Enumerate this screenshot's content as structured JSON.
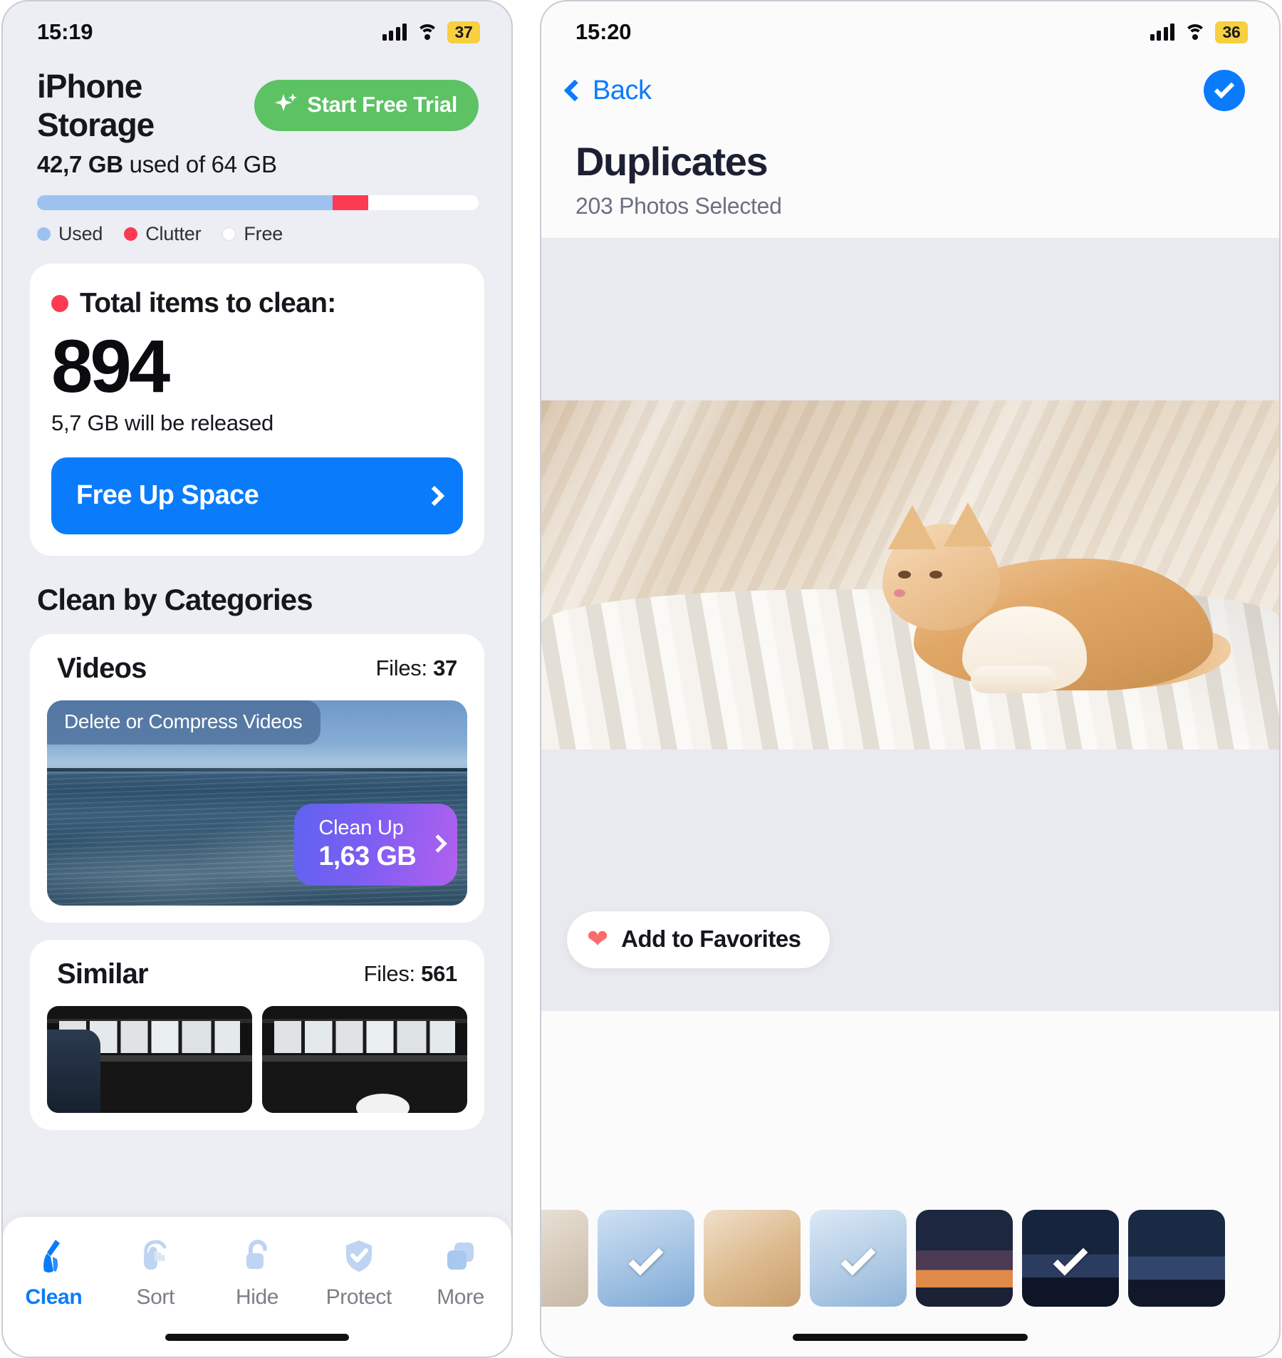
{
  "left": {
    "status": {
      "time": "15:19",
      "battery": "37",
      "signal_icon": "cellular-signal-icon",
      "wifi_icon": "wifi-icon"
    },
    "header": {
      "title": "iPhone Storage",
      "trial_button": "Start Free Trial",
      "trial_icon": "sparkle-icon",
      "usage_used": "42,7 GB",
      "usage_rest": " used of 64 GB"
    },
    "storage_bar": {
      "used_pct": 67,
      "clutter_pct": 8,
      "free_pct": 25,
      "used_color": "#9dc2ef",
      "clutter_color": "#fb3b53",
      "free_color": "#ffffff"
    },
    "legend": [
      {
        "label": "Used",
        "color": "#9dc2ef"
      },
      {
        "label": "Clutter",
        "color": "#fb3b53"
      },
      {
        "label": "Free",
        "color": "#ffffff"
      }
    ],
    "summary_card": {
      "dot_color": "#fb3b53",
      "heading": "Total items to clean:",
      "count": "894",
      "released": "5,7 GB will be released",
      "cta_label": "Free Up Space",
      "cta_color": "#0a7cfb",
      "cta_chevron": "chevron-right-icon"
    },
    "categories_heading": "Clean by Categories",
    "categories": [
      {
        "name": "Videos",
        "files_label": "Files: ",
        "files_count": "37",
        "media_chip": "Delete or Compress Videos",
        "cleanup_label": "Clean Up",
        "cleanup_size": "1,63 GB"
      },
      {
        "name": "Similar",
        "files_label": "Files: ",
        "files_count": "561"
      }
    ],
    "tabs": [
      {
        "label": "Clean",
        "icon": "broom-icon",
        "active": true
      },
      {
        "label": "Sort",
        "icon": "swipe-hand-icon",
        "active": false
      },
      {
        "label": "Hide",
        "icon": "unlock-icon",
        "active": false
      },
      {
        "label": "Protect",
        "icon": "shield-check-icon",
        "active": false
      },
      {
        "label": "More",
        "icon": "stacked-squares-icon",
        "active": false
      }
    ],
    "active_tab_color": "#0a7cfb"
  },
  "right": {
    "status": {
      "time": "15:20",
      "battery": "36",
      "signal_icon": "cellular-signal-icon",
      "wifi_icon": "wifi-icon"
    },
    "nav": {
      "back_label": "Back",
      "back_icon": "chevron-left-icon",
      "select_all_icon": "check-circle-icon",
      "select_all_color": "#0a7cfb"
    },
    "title": "Duplicates",
    "subtitle": "203 Photos Selected",
    "favorites": {
      "label": "Add to Favorites",
      "icon": "heart-icon",
      "icon_color": "#fb6b6b"
    },
    "thumbnails": [
      {
        "name": "white-cat-thumb",
        "style": "t-catwhite",
        "selected": false
      },
      {
        "name": "blue-hand-thumb",
        "style": "t-blue",
        "selected": true
      },
      {
        "name": "ginger-cat-thumb",
        "style": "t-warm",
        "selected": false
      },
      {
        "name": "cat-window-thumb",
        "style": "t-lblue",
        "selected": true
      },
      {
        "name": "sunset-thumb",
        "style": "t-sunset",
        "selected": false
      },
      {
        "name": "dusk-trees-thumb",
        "style": "t-dusk",
        "selected": true
      },
      {
        "name": "dusk-trees-alt-thumb",
        "style": "t-dusk2",
        "selected": false
      }
    ]
  }
}
